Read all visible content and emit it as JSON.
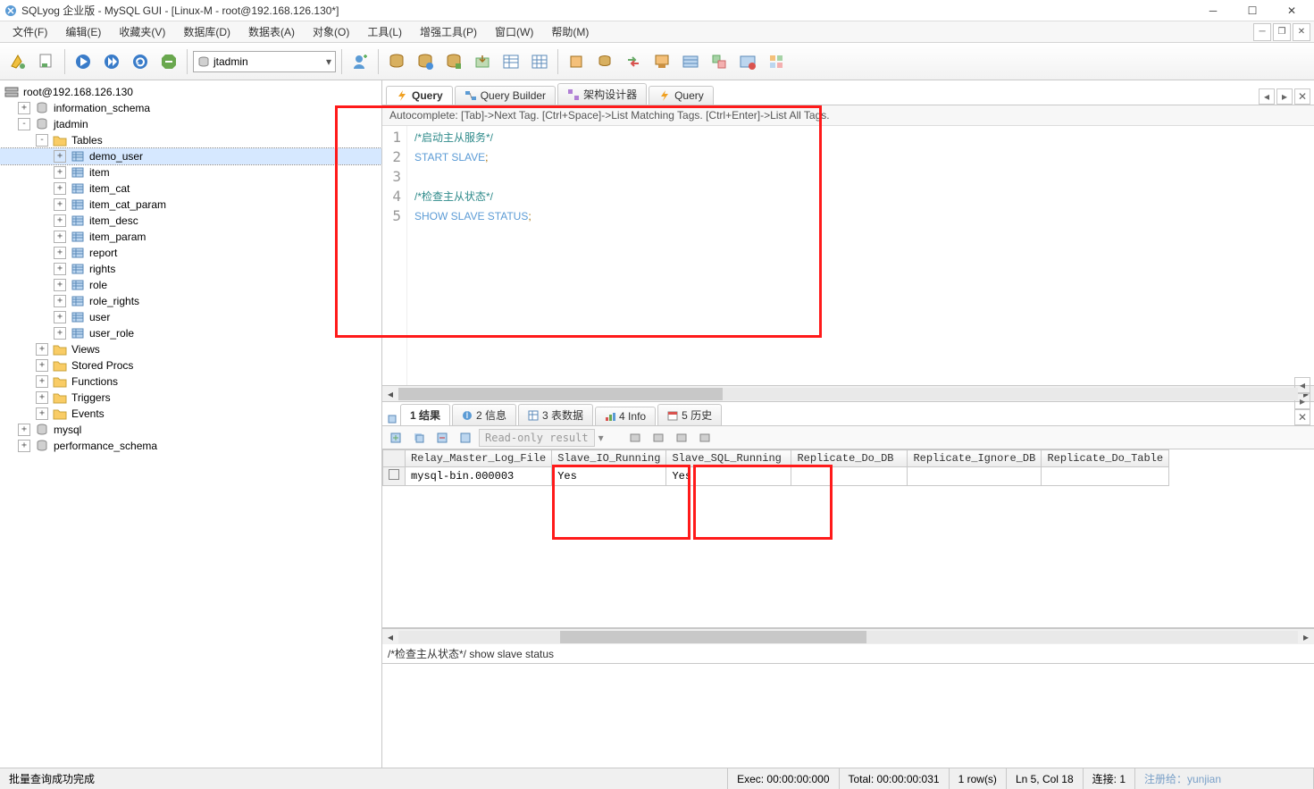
{
  "window": {
    "title": "SQLyog 企业版 - MySQL GUI - [Linux-M - root@192.168.126.130*]"
  },
  "menu": {
    "file": "文件(F)",
    "edit": "编辑(E)",
    "fav": "收藏夹(V)",
    "database": "数据库(D)",
    "table": "数据表(A)",
    "objects": "对象(O)",
    "tools": "工具(L)",
    "power": "增强工具(P)",
    "window": "窗口(W)",
    "help": "帮助(M)"
  },
  "toolbar": {
    "db_selected": "jtadmin"
  },
  "tree": {
    "root": "root@192.168.126.130",
    "db1": "information_schema",
    "db2": "jtadmin",
    "tables_label": "Tables",
    "tables": [
      "demo_user",
      "item",
      "item_cat",
      "item_cat_param",
      "item_desc",
      "item_param",
      "report",
      "rights",
      "role",
      "role_rights",
      "user",
      "user_role"
    ],
    "views": "Views",
    "procs": "Stored Procs",
    "funcs": "Functions",
    "trigs": "Triggers",
    "events": "Events",
    "db3": "mysql",
    "db4": "performance_schema"
  },
  "tabs": {
    "query": "Query",
    "builder": "Query Builder",
    "schema": "架构设计器",
    "query2": "Query"
  },
  "autocomplete_hint": "Autocomplete: [Tab]->Next Tag. [Ctrl+Space]->List Matching Tags. [Ctrl+Enter]->List All Tags.",
  "code": {
    "l1": {
      "cm": "/*启动主从服务*/"
    },
    "l2": {
      "kw": "START SLAVE",
      "p": ";"
    },
    "l3": "",
    "l4": {
      "cm": "/*检查主从状态*/"
    },
    "l5": {
      "kw": "SHOW SLAVE STATUS",
      "p": ";"
    }
  },
  "result_tabs": {
    "r1": "1 结果",
    "r2": "2 信息",
    "r3": "3 表数据",
    "r4": "4 Info",
    "r5": "5 历史",
    "readonly": "Read-only result"
  },
  "grid": {
    "headers": [
      "Relay_Master_Log_File",
      "Slave_IO_Running",
      "Slave_SQL_Running",
      "Replicate_Do_DB",
      "Replicate_Ignore_DB",
      "Replicate_Do_Table"
    ],
    "row1": {
      "c0": "mysql-bin.000003",
      "c1": "Yes",
      "c2": "Yes",
      "c3": "",
      "c4": "",
      "c5": ""
    }
  },
  "grid_status": "/*检查主从状态*/ show slave status",
  "status": {
    "left": "批量查询成功完成",
    "exec": "Exec: 00:00:00:000",
    "total": "Total: 00:00:00:031",
    "rows": "1 row(s)",
    "pos": "Ln 5, Col 18",
    "conn": "连接: 1",
    "reg": "注册给：yunjian"
  }
}
